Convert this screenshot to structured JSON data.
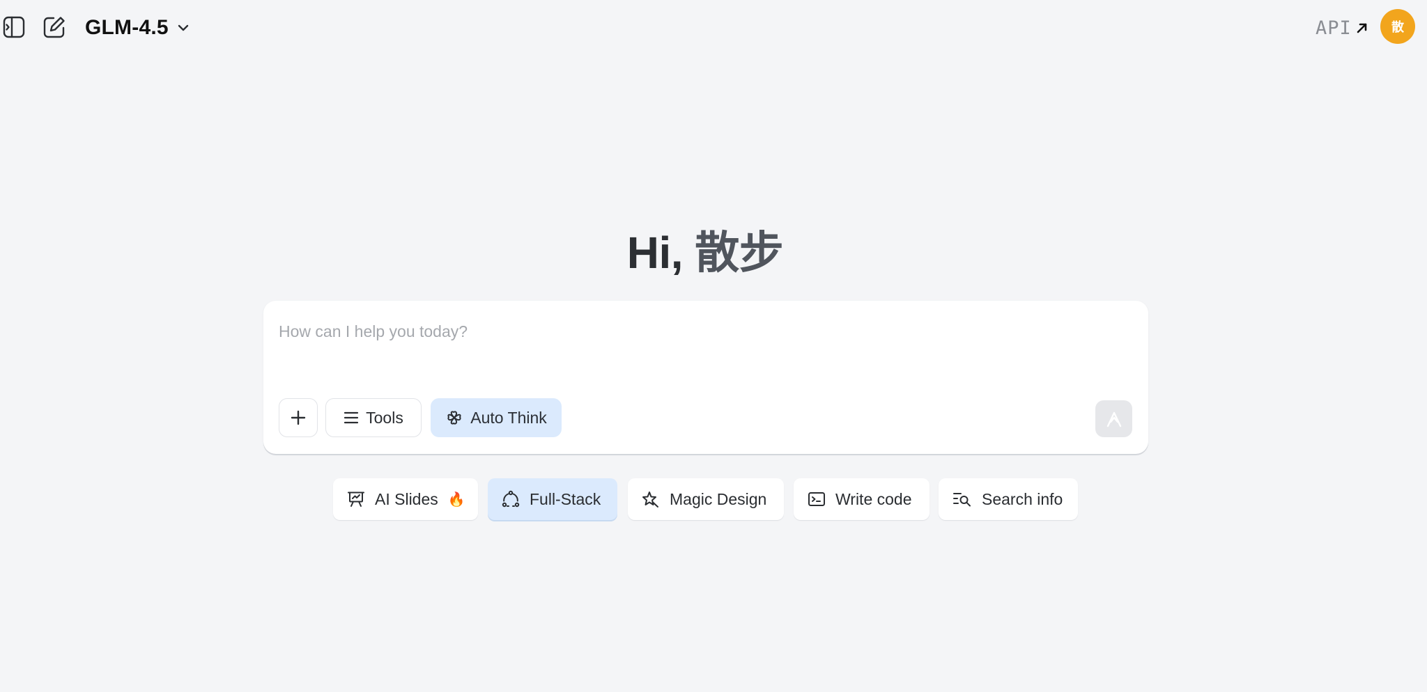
{
  "header": {
    "model_name": "GLM-4.5",
    "api_label": "API",
    "avatar_text": "散",
    "avatar_color": "#f2a51d"
  },
  "greeting": {
    "hi": "Hi,",
    "name": "散步"
  },
  "composer": {
    "placeholder": "How can I help you today?",
    "value": "",
    "tools_label": "Tools",
    "auto_think_label": "Auto Think"
  },
  "suggestions": [
    {
      "label": "AI Slides",
      "emoji": "🔥",
      "icon": "presentation-icon",
      "active": false
    },
    {
      "label": "Full-Stack",
      "icon": "nodes-icon",
      "active": true
    },
    {
      "label": "Magic Design",
      "icon": "sparkle-icon",
      "active": false
    },
    {
      "label": "Write code",
      "icon": "terminal-icon",
      "active": false
    },
    {
      "label": "Search info",
      "icon": "search-list-icon",
      "active": false
    }
  ],
  "colors": {
    "background": "#f4f5f7",
    "accent_light": "#dbeafd"
  }
}
